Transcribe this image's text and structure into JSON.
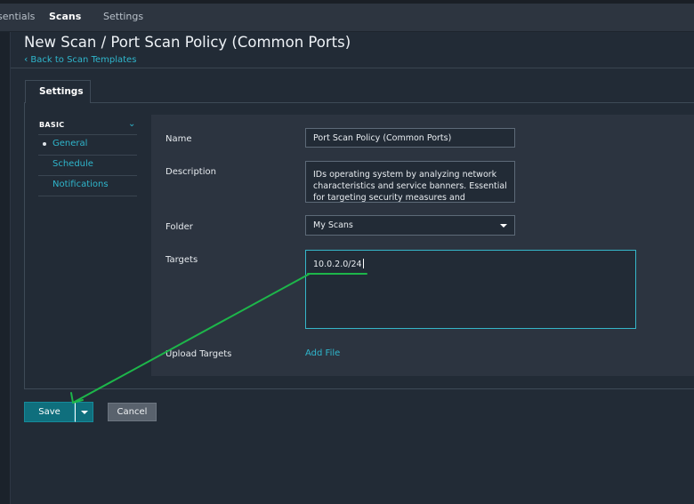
{
  "topnav": {
    "items": [
      {
        "label": "sentials",
        "active": false
      },
      {
        "label": "Scans",
        "active": true
      },
      {
        "label": "Settings",
        "active": false
      }
    ]
  },
  "header": {
    "title": "New Scan / Port Scan Policy (Common Ports)",
    "back_link": "Back to Scan Templates"
  },
  "tabs": [
    {
      "label": "Settings",
      "active": true
    }
  ],
  "sidebar": {
    "section": "BASIC",
    "items": [
      {
        "label": "General",
        "active": true
      },
      {
        "label": "Schedule",
        "active": false
      },
      {
        "label": "Notifications",
        "active": false
      }
    ]
  },
  "form": {
    "name": {
      "label": "Name",
      "value": "Port Scan Policy (Common Ports)"
    },
    "description": {
      "label": "Description",
      "value": "IDs operating system by analyzing network characteristics and service banners. Essential for targeting security measures and"
    },
    "folder": {
      "label": "Folder",
      "value": "My Scans"
    },
    "targets": {
      "label": "Targets",
      "value": "10.0.2.0/24"
    },
    "upload": {
      "label": "Upload Targets",
      "action": "Add File"
    }
  },
  "actions": {
    "save_label": "Save",
    "cancel_label": "Cancel"
  },
  "colors": {
    "accent": "#2fb6cc",
    "primary_button": "#0f6f7d",
    "background": "#222b36",
    "annotation": "#1db64a"
  },
  "icons": {
    "back": "chevron-left-icon",
    "collapse": "chevron-down-icon",
    "dropdown": "caret-down-icon"
  }
}
